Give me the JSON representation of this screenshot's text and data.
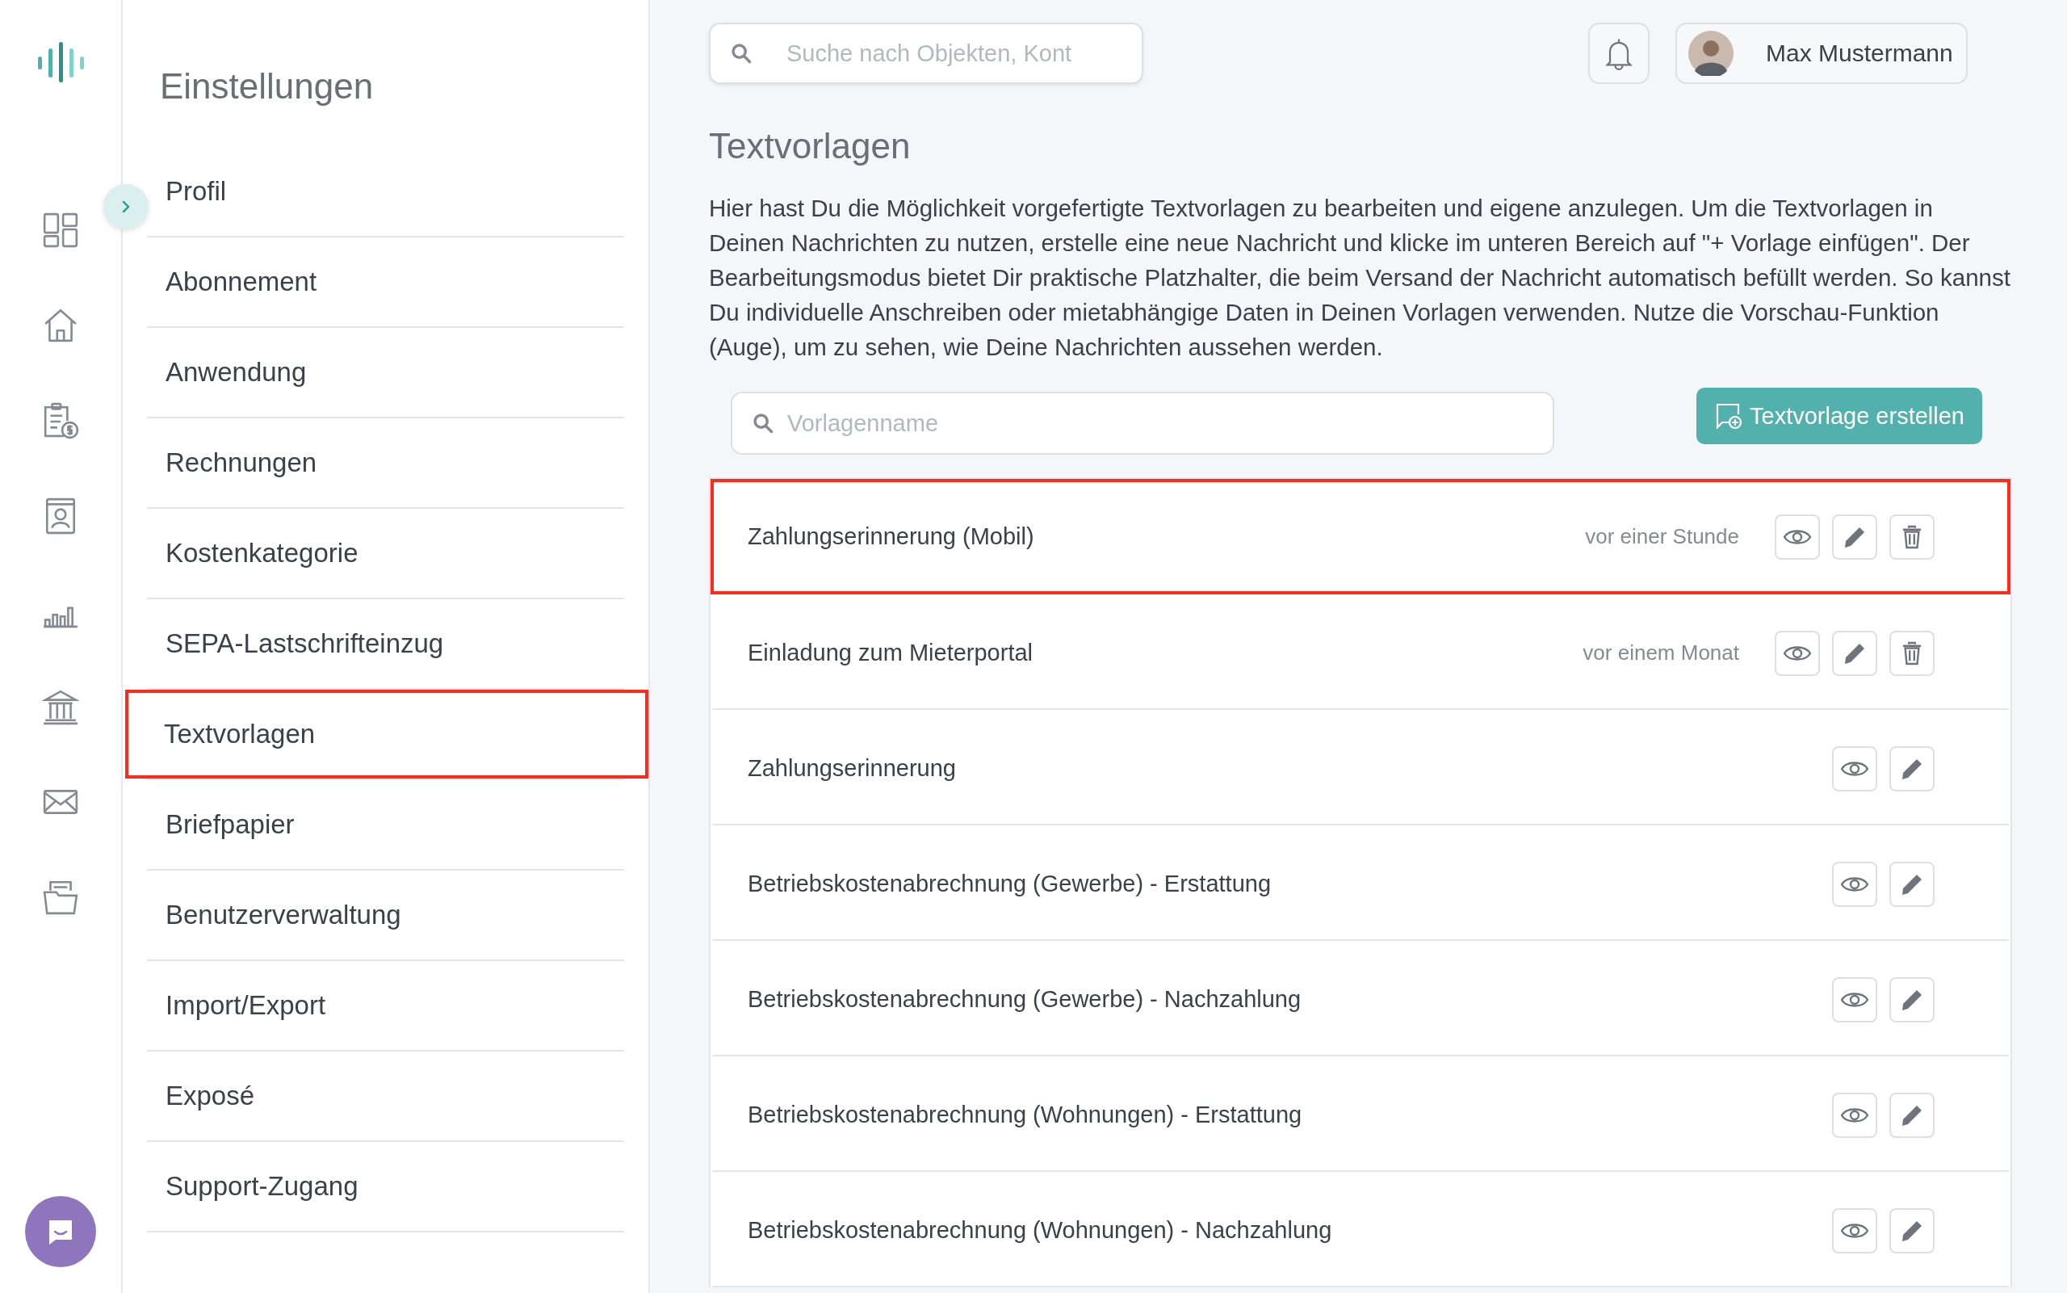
{
  "rail": {
    "items": [
      {
        "kind": "dashboard"
      },
      {
        "kind": "home"
      },
      {
        "kind": "invoice"
      },
      {
        "kind": "contact"
      },
      {
        "kind": "chart"
      },
      {
        "kind": "bank"
      },
      {
        "kind": "mail"
      },
      {
        "kind": "folder"
      }
    ]
  },
  "settings": {
    "title": "Einstellungen",
    "items": [
      {
        "label": "Profil",
        "selected": false
      },
      {
        "label": "Abonnement",
        "selected": false
      },
      {
        "label": "Anwendung",
        "selected": false
      },
      {
        "label": "Rechnungen",
        "selected": false
      },
      {
        "label": "Kostenkategorie",
        "selected": false
      },
      {
        "label": "SEPA-Lastschrifteinzug",
        "selected": false
      },
      {
        "label": "Textvorlagen",
        "selected": true
      },
      {
        "label": "Briefpapier",
        "selected": false
      },
      {
        "label": "Benutzerverwaltung",
        "selected": false
      },
      {
        "label": "Import/Export",
        "selected": false
      },
      {
        "label": "Exposé",
        "selected": false
      },
      {
        "label": "Support-Zugang",
        "selected": false
      }
    ]
  },
  "topbar": {
    "search_placeholder": "Suche nach Objekten, Kont",
    "user": "Max Mustermann"
  },
  "page": {
    "title": "Textvorlagen",
    "intro": "Hier hast Du die Möglichkeit vorgefertigte Textvorlagen zu bearbeiten und eigene anzulegen. Um die Textvorlagen in Deinen Nachrichten zu nutzen, erstelle eine neue Nachricht und klicke im unteren Bereich auf \"+ Vorlage einfügen\". Der Bearbeitungsmodus bietet Dir praktische Platzhalter, die beim Versand der Nachricht automatisch befüllt werden. So kannst Du individuelle Anschreiben oder mietabhängige Daten in Deinen Vorlagen verwenden. Nutze die Vorschau-Funktion (Auge), um zu sehen, wie Deine Nachrichten aussehen werden.",
    "filter_placeholder": "Vorlagenname",
    "create_button": "Textvorlage erstellen"
  },
  "templates": [
    {
      "name": "Zahlungserinnerung (Mobil)",
      "time": "vor einer Stunde",
      "deletable": true,
      "highlighted": true
    },
    {
      "name": "Einladung zum Mieterportal",
      "time": "vor einem Monat",
      "deletable": true,
      "highlighted": false
    },
    {
      "name": "Zahlungserinnerung",
      "deletable": false,
      "highlighted": false
    },
    {
      "name": "Betriebskostenabrechnung (Gewerbe) - Erstattung",
      "deletable": false,
      "highlighted": false
    },
    {
      "name": "Betriebskostenabrechnung (Gewerbe) - Nachzahlung",
      "deletable": false,
      "highlighted": false
    },
    {
      "name": "Betriebskostenabrechnung (Wohnungen) - Erstattung",
      "deletable": false,
      "highlighted": false
    },
    {
      "name": "Betriebskostenabrechnung (Wohnungen) - Nachzahlung",
      "deletable": false,
      "highlighted": false
    }
  ]
}
